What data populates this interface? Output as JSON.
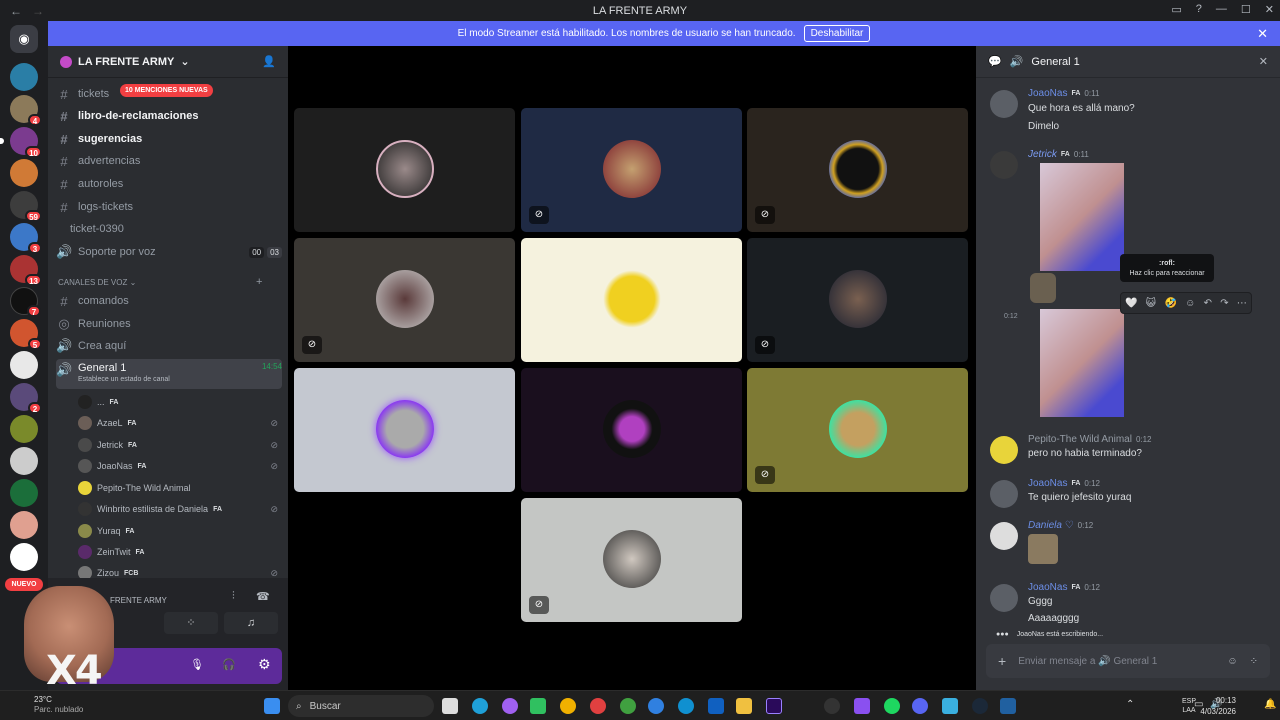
{
  "window": {
    "title": "LA FRENTE ARMY",
    "controls": [
      "—",
      "☐",
      "✕"
    ]
  },
  "banner": {
    "text": "El modo Streamer está habilitado. Los nombres de usuario se han truncado.",
    "button": "Deshabilitar"
  },
  "servers": {
    "badges": [
      "4",
      "10",
      "59",
      "3",
      "13",
      "7",
      "5",
      "2"
    ],
    "new_label": "NUEVO"
  },
  "sidebar": {
    "guild_name": "LA FRENTE ARMY",
    "mentions_pill": "10 MENCIONES NUEVAS",
    "channels": [
      {
        "icon": "#",
        "label": "tickets"
      },
      {
        "icon": "#",
        "label": "libro-de-reclamaciones"
      },
      {
        "icon": "#",
        "label": "sugerencias"
      },
      {
        "icon": "#",
        "label": "advertencias"
      },
      {
        "icon": "#",
        "label": "autoroles"
      },
      {
        "icon": "#",
        "label": "logs-tickets"
      },
      {
        "icon": "",
        "label": "ticket-0390"
      },
      {
        "icon": "🔊",
        "label": "Soporte por voz",
        "count_a": "00",
        "count_b": "03"
      }
    ],
    "voice_category": "CANALES DE VOZ",
    "voice_channels": [
      {
        "icon": "#",
        "label": "comandos"
      },
      {
        "icon": "◎",
        "label": "Reuniones"
      },
      {
        "icon": "🔊",
        "label": "Crea aquí"
      },
      {
        "icon": "🔊",
        "label": "General 1",
        "time": "14:54",
        "status": "Establece un estado de canal"
      }
    ],
    "voice_users": [
      {
        "name": "...",
        "tag": "FA"
      },
      {
        "name": "AzaeL",
        "tag": "FA"
      },
      {
        "name": "Jetrick",
        "tag": "FA"
      },
      {
        "name": "JoaoNas",
        "tag": "FA"
      },
      {
        "name": "Pepito-The Wild Animal",
        "tag": ""
      },
      {
        "name": "Winbrito estilista de Daniela",
        "tag": "FA"
      },
      {
        "name": "Yuraq",
        "tag": "FA"
      },
      {
        "name": "ZeinTwit",
        "tag": "FA"
      },
      {
        "name": "Zizou",
        "tag": "FCB"
      }
    ],
    "voice_panel": {
      "server_label": "FRENTE ARMY",
      "overlay_text": "X4"
    }
  },
  "grid": {
    "tiles": 10
  },
  "chat": {
    "channel_name": "General 1",
    "messages": [
      {
        "name": "JoaoNas",
        "tag": "FA",
        "time": "0:11",
        "lines": [
          "Que hora es allá mano?",
          "Dimelo"
        ]
      },
      {
        "name": "Jetrick",
        "tag": "FA",
        "time": "0:11",
        "lines": []
      },
      {
        "name": "Pepito-The Wild Animal",
        "tag": "",
        "time": "0:12",
        "lines": [
          "pero no habia terminado?"
        ]
      },
      {
        "name": "JoaoNas",
        "tag": "FA",
        "time": "0:12",
        "lines": [
          "Te quiero jefesito yuraq"
        ]
      },
      {
        "name": "Daniela ♡",
        "tag": "",
        "time": "0:12",
        "lines": []
      },
      {
        "name": "JoaoNas",
        "tag": "FA",
        "time": "0:12",
        "lines": [
          "Gggg",
          "Aaaaagggg"
        ]
      }
    ],
    "side_time": "0:12",
    "tooltip_title": ":rofl:",
    "tooltip_sub": "Haz clic para reaccionar",
    "typing": "JoaoNas está escribiendo...",
    "input_placeholder": "Enviar mensaje a 🔊 General 1"
  },
  "taskbar": {
    "temp": "23°C",
    "weather": "Parc. nublado",
    "search": "Buscar",
    "lang": "ESP",
    "lang2": "LAA",
    "time": "00:13",
    "date": "4/03/2026"
  }
}
